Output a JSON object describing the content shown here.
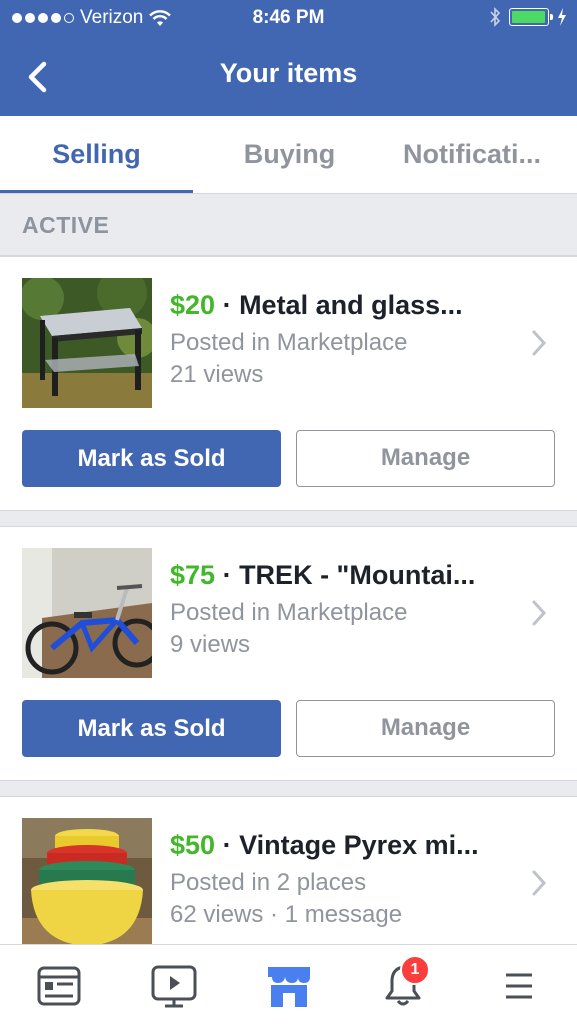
{
  "status_bar": {
    "carrier": "Verizon",
    "time": "8:46 PM"
  },
  "header": {
    "title": "Your items"
  },
  "tabs": [
    {
      "label": "Selling",
      "active": true
    },
    {
      "label": "Buying",
      "active": false
    },
    {
      "label": "Notificati..."
    }
  ],
  "section": {
    "title": "ACTIVE"
  },
  "items": [
    {
      "price": "$20",
      "separator": " · ",
      "title": "Metal and glass...",
      "posted": "Posted in Marketplace",
      "stats": "21 views",
      "mark_sold_label": "Mark as Sold",
      "manage_label": "Manage"
    },
    {
      "price": "$75",
      "separator": " · ",
      "title": "TREK - \"Mountai...",
      "posted": "Posted in Marketplace",
      "stats": "9 views",
      "mark_sold_label": "Mark as Sold",
      "manage_label": "Manage"
    },
    {
      "price": "$50",
      "separator": " · ",
      "title": "Vintage Pyrex mi...",
      "posted": "Posted in 2 places",
      "stats": "62 views · 1 message"
    }
  ],
  "bottom_nav": {
    "notifications_badge": "1",
    "icons": [
      "news-feed-icon",
      "watch-icon",
      "marketplace-icon",
      "notifications-icon",
      "menu-icon"
    ]
  },
  "colors": {
    "brand": "#4267b2",
    "price": "#42b72a",
    "muted": "#90949c",
    "badge": "#fa3e3e"
  }
}
